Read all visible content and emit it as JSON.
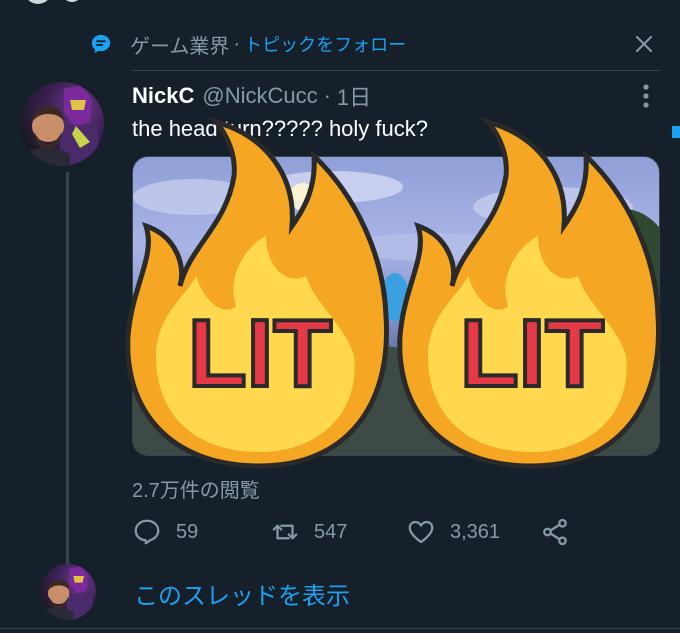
{
  "topic": {
    "name": "ゲーム業界",
    "separator": "·",
    "follow_label": "トピックをフォロー",
    "icon": "topic-bubble-icon",
    "close_icon": "close-icon"
  },
  "tweet": {
    "author_name": "NickC",
    "author_handle": "@NickCucc",
    "time_sep": "·",
    "time": "1日",
    "text": "the head turn????? holy fuck?",
    "views": "2.7万件の閲覧",
    "media_overlay": {
      "emoji": "lit-fire-emoji",
      "label": "LIT",
      "count": 2
    }
  },
  "actions": {
    "reply": {
      "icon": "reply-icon",
      "count": "59"
    },
    "retweet": {
      "icon": "retweet-icon",
      "count": "547"
    },
    "like": {
      "icon": "heart-icon",
      "count": "3,361"
    },
    "share": {
      "icon": "share-icon"
    }
  },
  "thread": {
    "show_thread_label": "このスレッドを表示"
  },
  "colors": {
    "background": "#15202b",
    "accent": "#1da1f2",
    "muted_text": "#8899a6",
    "divider": "#38444d",
    "fire_outer": "#f5a623",
    "fire_inner": "#ffd84d",
    "lit_text": "#e63946"
  }
}
